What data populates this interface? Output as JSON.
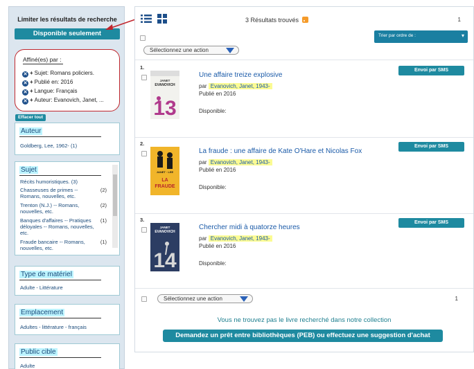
{
  "sidebar": {
    "limit_title": "Limiter les résultats de recherche",
    "available_only": "Disponible seulement",
    "refine_title": "Affiné(es) par :",
    "refine_items": [
      "Sujet: Romans policiers.",
      "Publié en: 2016",
      "Langue: Français",
      "Auteur: Evanovich, Janet, ..."
    ],
    "clear_all": "Effacer tout",
    "facets": {
      "author": {
        "title": "Auteur",
        "item": "Goldberg, Lee, 1962- (1)"
      },
      "subject": {
        "title": "Sujet",
        "items": [
          {
            "label": "Récits humoristiques. (3)",
            "count": ""
          },
          {
            "label": "Chasseuses de primes -- Romans, nouvelles, etc.",
            "count": "(2)"
          },
          {
            "label": "Trenton (N.J.) -- Romans, nouvelles, etc.",
            "count": "(2)"
          },
          {
            "label": "Banques d'affaires -- Pratiques déloyales -- Romans, nouvelles, etc.",
            "count": "(1)"
          },
          {
            "label": "Fraude bancaire -- Romans, nouvelles, etc.",
            "count": "(1)"
          }
        ]
      },
      "material": {
        "title": "Type de matériel",
        "item": "Adulte - Littérature"
      },
      "location": {
        "title": "Emplacement",
        "item": "Adultes - littérature - français"
      },
      "audience": {
        "title": "Public cible",
        "item": "Adulte"
      }
    }
  },
  "main": {
    "results_count": "3 Résultats trouvés",
    "page": "1",
    "sort_label": "Trier par ordre de :",
    "action_label": "Sélectionnez une action",
    "sms_label": "Envoi par SMS",
    "author_prefix": "par",
    "results": [
      {
        "num": "1.",
        "title": "Une affaire treize explosive",
        "author": "Evanovich, Janet, 1943-",
        "published": "Publié en 2016",
        "availability": "Disponible:",
        "cover_bg": "#f2f2ee",
        "cover_accent": "#b03a8c"
      },
      {
        "num": "2.",
        "title": "La fraude : une affaire de Kate O'Hare et Nicolas Fox",
        "author": "Evanovich, Janet, 1943-",
        "published": "Publié en 2016",
        "availability": "Disponible:",
        "cover_bg": "#f1b52a",
        "cover_accent": "#1a1a1a"
      },
      {
        "num": "3.",
        "title": "Chercher midi à quatorze heures",
        "author": "Evanovich, Janet, 1943-",
        "published": "Publié en 2016",
        "availability": "Disponible:",
        "cover_bg": "#2c3d63",
        "cover_accent": "#d7d7d7"
      }
    ],
    "bottom_page": "1",
    "not_found": "Vous ne trouvez pas le livre recherché dans notre collection",
    "ill_button": "Demandez un prêt entre bibliothèques (PEB) ou effectuez une suggestion d'achat"
  }
}
